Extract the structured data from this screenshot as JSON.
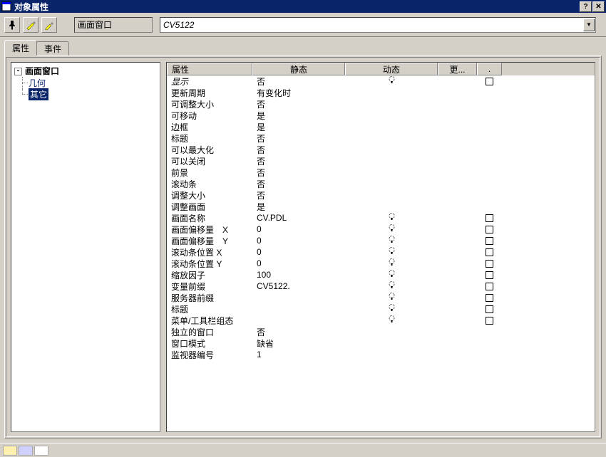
{
  "title": "对象属性",
  "toolbar": {
    "objTypeLabel": "画面窗口",
    "objDropdown": "CV5122"
  },
  "tabs": [
    {
      "label": "属性",
      "active": true
    },
    {
      "label": "事件",
      "active": false
    }
  ],
  "tree": {
    "root": "画面窗口",
    "children": [
      {
        "label": "几何",
        "selected": false
      },
      {
        "label": "其它",
        "selected": true
      }
    ]
  },
  "gridHeaders": {
    "attr": "属性",
    "static": "静态",
    "dynamic": "动态",
    "update": "更...",
    "indirect": "."
  },
  "rows": [
    {
      "name": "显示",
      "nameItalic": true,
      "value": "否",
      "bulb": true,
      "check": true
    },
    {
      "name": "更新周期",
      "value": "有变化时"
    },
    {
      "name": "可调整大小",
      "value": "否"
    },
    {
      "name": "可移动",
      "value": "是"
    },
    {
      "name": "边框",
      "value": "是"
    },
    {
      "name": "标题",
      "value": "否"
    },
    {
      "name": "可以最大化",
      "value": "否"
    },
    {
      "name": "可以关闭",
      "value": "否"
    },
    {
      "name": "前景",
      "value": "否"
    },
    {
      "name": "滚动条",
      "value": "否"
    },
    {
      "name": "调整大小",
      "value": "否"
    },
    {
      "name": "调整画面",
      "value": "是"
    },
    {
      "name": "画面名称",
      "value": "CV.PDL",
      "bulb": true,
      "check": true
    },
    {
      "name": "画面偏移量　X",
      "value": "0",
      "bulb": true,
      "check": true
    },
    {
      "name": "画面偏移量　Y",
      "value": "0",
      "bulb": true,
      "check": true
    },
    {
      "name": "滚动条位置 X",
      "value": "0",
      "bulb": true,
      "check": true
    },
    {
      "name": "滚动条位置 Y",
      "value": "0",
      "bulb": true,
      "check": true
    },
    {
      "name": "缩放因子",
      "value": "100",
      "bulb": true,
      "check": true
    },
    {
      "name": "变量前缀",
      "value": "CV5122.",
      "bulb": true,
      "check": true
    },
    {
      "name": "服务器前缀",
      "value": "",
      "bulb": true,
      "check": true
    },
    {
      "name": "标题",
      "value": "",
      "bulb": true,
      "check": true
    },
    {
      "name": "菜单/工具栏组态",
      "value": "",
      "bulb": true,
      "check": true
    },
    {
      "name": "独立的窗口",
      "value": "否"
    },
    {
      "name": "窗口模式",
      "value": "缺省"
    },
    {
      "name": "监视器编号",
      "value": "1"
    }
  ]
}
